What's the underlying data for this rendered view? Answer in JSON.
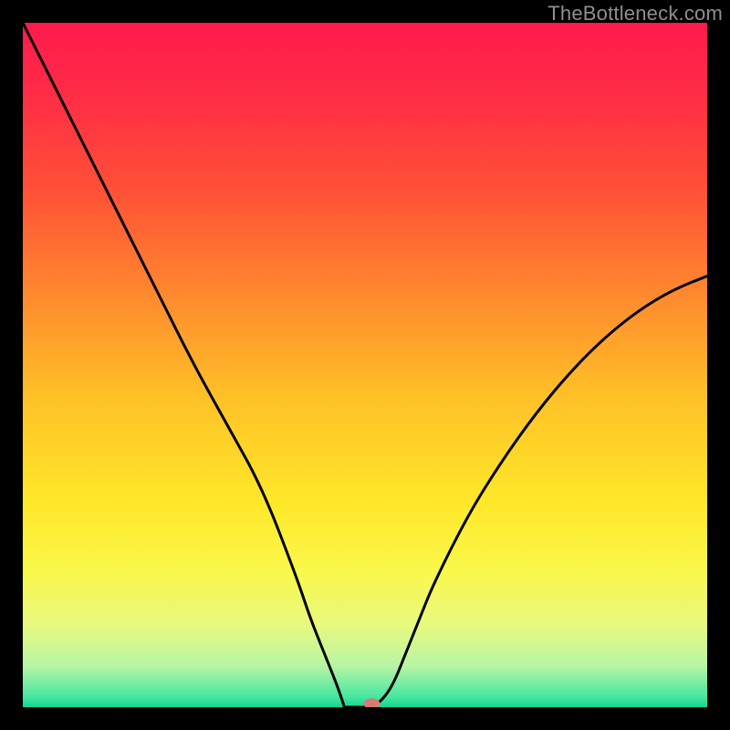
{
  "watermark": "TheBottleneck.com",
  "chart_data": {
    "type": "line",
    "title": "",
    "xlabel": "",
    "ylabel": "",
    "xlim": [
      0,
      100
    ],
    "ylim": [
      0,
      100
    ],
    "series": [
      {
        "name": "curve",
        "x": [
          0,
          5,
          10,
          15,
          20,
          25,
          30,
          35,
          40,
          42,
          44,
          46,
          48,
          50,
          52,
          54,
          56,
          58,
          60,
          65,
          70,
          75,
          80,
          85,
          90,
          95,
          100
        ],
        "y": [
          100,
          90,
          80,
          70,
          60,
          50,
          41,
          32,
          19,
          13,
          8,
          3,
          1,
          0,
          0.5,
          3,
          8,
          13,
          18,
          28,
          36,
          43,
          49,
          54,
          58,
          61,
          63
        ]
      }
    ],
    "flat_segment": {
      "x0": 47,
      "x1": 51,
      "y": 0
    },
    "marker": {
      "x": 51,
      "y": 0.5,
      "color": "#d87a74"
    },
    "background_gradient": {
      "stops": [
        {
          "offset": 0.0,
          "color": "#ff1a4d"
        },
        {
          "offset": 0.1,
          "color": "#ff2b46"
        },
        {
          "offset": 0.25,
          "color": "#ff5236"
        },
        {
          "offset": 0.4,
          "color": "#ff8a2e"
        },
        {
          "offset": 0.55,
          "color": "#ffc227"
        },
        {
          "offset": 0.7,
          "color": "#ffe72a"
        },
        {
          "offset": 0.8,
          "color": "#faf84a"
        },
        {
          "offset": 0.88,
          "color": "#e8f97e"
        },
        {
          "offset": 0.94,
          "color": "#b7f5a5"
        },
        {
          "offset": 0.985,
          "color": "#47e6a0"
        },
        {
          "offset": 1.0,
          "color": "#10d890"
        }
      ]
    },
    "curve_color": "#000000",
    "curve_width": 3
  }
}
